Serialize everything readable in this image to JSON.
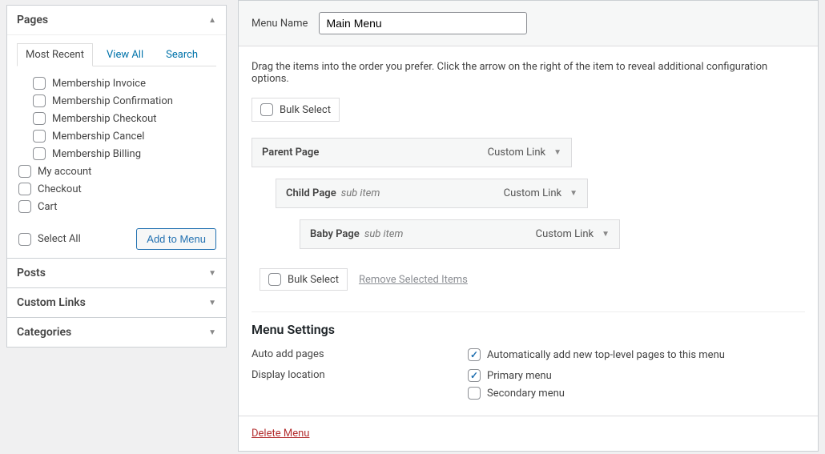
{
  "sidebar": {
    "pages": {
      "title": "Pages",
      "tabs": [
        "Most Recent",
        "View All",
        "Search"
      ],
      "items": [
        "Membership Invoice",
        "Membership Confirmation",
        "Membership Checkout",
        "Membership Cancel",
        "Membership Billing",
        "My account",
        "Checkout",
        "Cart"
      ],
      "select_all": "Select All",
      "add_btn": "Add to Menu"
    },
    "collapsed_panels": [
      "Posts",
      "Custom Links",
      "Categories"
    ]
  },
  "menu": {
    "name_label": "Menu Name",
    "name_value": "Main Menu",
    "instructions": "Drag the items into the order you prefer. Click the arrow on the right of the item to reveal additional configuration options.",
    "bulk_select": "Bulk Select",
    "remove_selected": "Remove Selected Items",
    "items": [
      {
        "title": "Parent Page",
        "sub": "",
        "type": "Custom Link"
      },
      {
        "title": "Child Page",
        "sub": "sub item",
        "type": "Custom Link"
      },
      {
        "title": "Baby Page",
        "sub": "sub item",
        "type": "Custom Link"
      }
    ]
  },
  "settings": {
    "heading": "Menu Settings",
    "auto_add_label": "Auto add pages",
    "auto_add_option": "Automatically add new top-level pages to this menu",
    "display_label": "Display location",
    "locations": [
      "Primary menu",
      "Secondary menu"
    ]
  },
  "delete": "Delete Menu"
}
